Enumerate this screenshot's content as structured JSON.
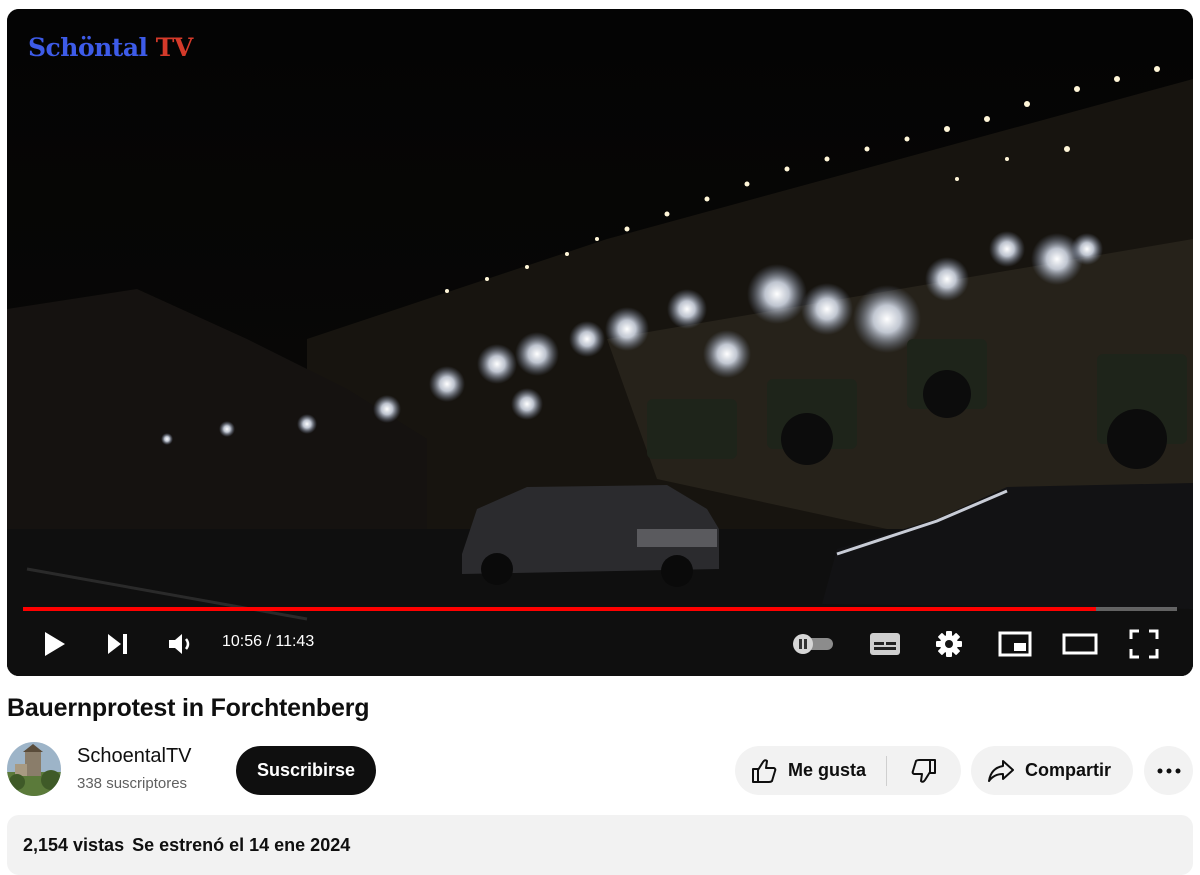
{
  "player": {
    "watermark_part1": "Schöntal",
    "watermark_part2": "TV",
    "time_display": "10:56 / 11:43",
    "progress_fraction": 0.93,
    "icons": [
      "play-icon",
      "next-icon",
      "volume-icon",
      "autoplay-toggle-icon",
      "subtitles-icon",
      "settings-icon",
      "miniplayer-icon",
      "theater-mode-icon",
      "fullscreen-icon"
    ]
  },
  "video": {
    "title": "Bauernprotest in Forchtenberg"
  },
  "channel": {
    "name": "SchoentalTV",
    "subscribers": "338 suscriptores",
    "subscribe_label": "Suscribirse"
  },
  "actions": {
    "like_label": "Me gusta",
    "share_label": "Compartir"
  },
  "description": {
    "views": "2,154 vistas",
    "premiere": "Se estrenó el 14 ene 2024"
  },
  "colors": {
    "progress": "#ff0000",
    "subscribe_bg": "#0f0f0f",
    "pill_bg": "#f2f2f2"
  }
}
